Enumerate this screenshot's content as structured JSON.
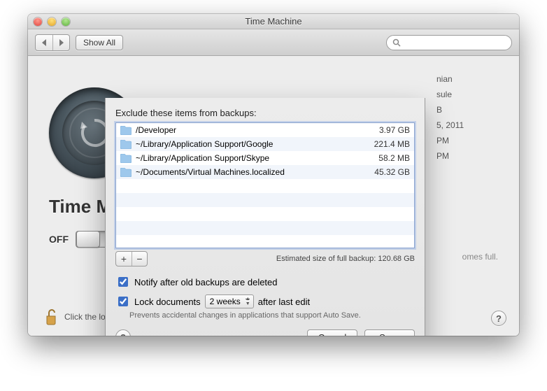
{
  "window": {
    "title": "Time Machine",
    "show_all": "Show All",
    "search_placeholder": ""
  },
  "main": {
    "app_title": "Time Machine",
    "switch_state": "OFF",
    "info_lines": [
      "nian",
      "sule",
      "B",
      "5, 2011",
      "PM",
      "PM"
    ],
    "becomes_full": "omes full.",
    "lock_caption": "Click the lock to prevent further changes."
  },
  "sheet": {
    "heading": "Exclude these items from backups:",
    "items": [
      {
        "path": "/Developer",
        "size": "3.97 GB"
      },
      {
        "path": "~/Library/Application Support/Google",
        "size": "221.4 MB"
      },
      {
        "path": "~/Library/Application Support/Skype",
        "size": "58.2 MB"
      },
      {
        "path": "~/Documents/Virtual Machines.localized",
        "size": "45.32 GB"
      }
    ],
    "add": "+",
    "remove": "−",
    "estimate_label": "Estimated size of full backup:",
    "estimate_value": "120.68 GB",
    "notify_label": "Notify after old backups are deleted",
    "notify_checked": true,
    "lock_label_before": "Lock documents",
    "lock_period": "2 weeks",
    "lock_label_after": "after last edit",
    "lock_checked": true,
    "lock_hint": "Prevents accidental changes in applications that support Auto Save.",
    "cancel": "Cancel",
    "save": "Save",
    "help": "?"
  }
}
